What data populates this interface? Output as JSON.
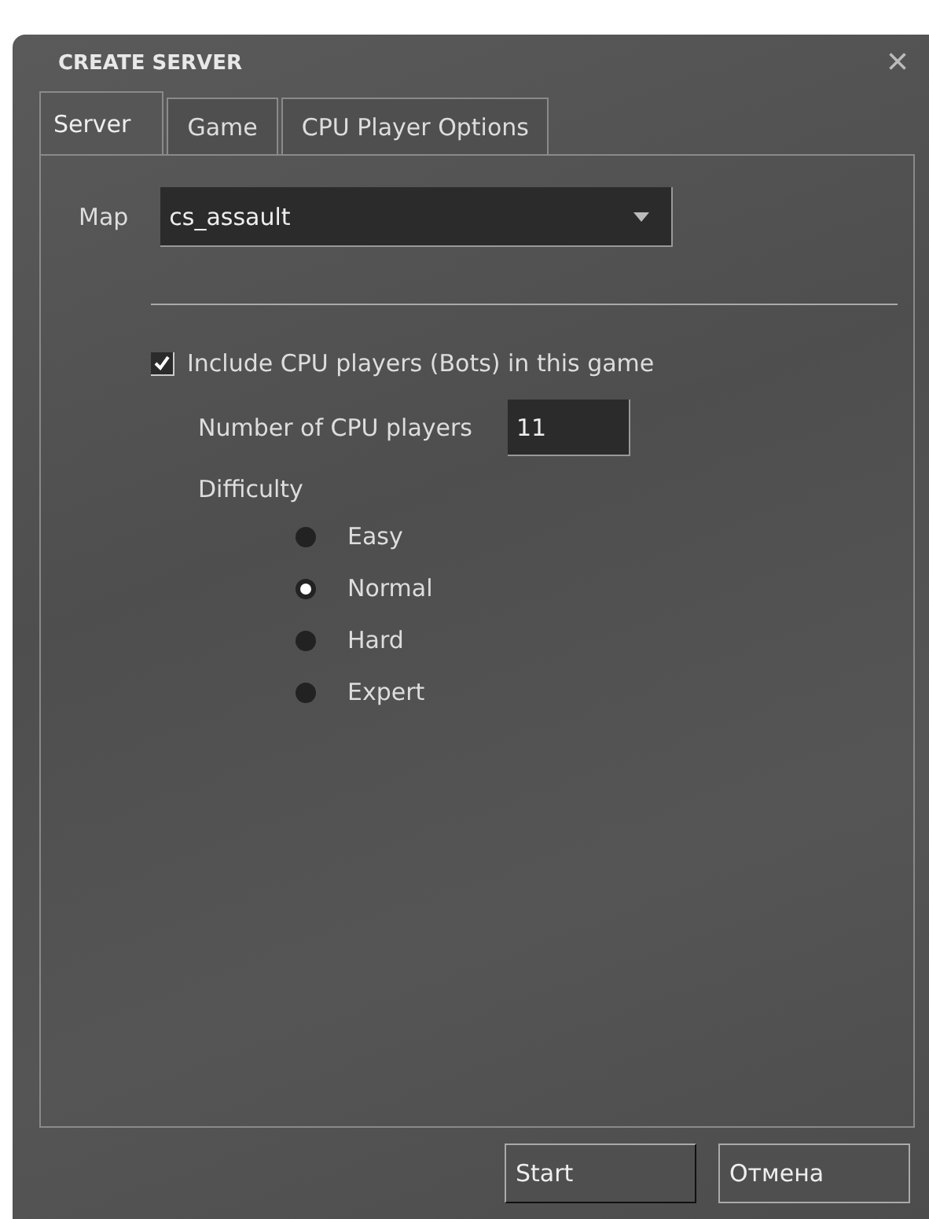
{
  "window": {
    "title": "CREATE SERVER",
    "close": "×"
  },
  "tabs": [
    {
      "label": "Server",
      "selected": true
    },
    {
      "label": "Game",
      "selected": false
    },
    {
      "label": "CPU Player Options",
      "selected": false
    }
  ],
  "map": {
    "label": "Map",
    "value": "cs_assault"
  },
  "bots": {
    "label": "Include CPU players (Bots) in this game",
    "checked": true
  },
  "count": {
    "label": "Number of CPU players",
    "value": "11"
  },
  "difficulty": {
    "label": "Difficulty",
    "options": [
      {
        "label": "Easy",
        "selected": false
      },
      {
        "label": "Normal",
        "selected": true
      },
      {
        "label": "Hard",
        "selected": false
      },
      {
        "label": "Expert",
        "selected": false
      }
    ]
  },
  "buttons": [
    {
      "label": "Start",
      "kind": "primary"
    },
    {
      "label": "Отмена",
      "kind": "secondary"
    }
  ]
}
